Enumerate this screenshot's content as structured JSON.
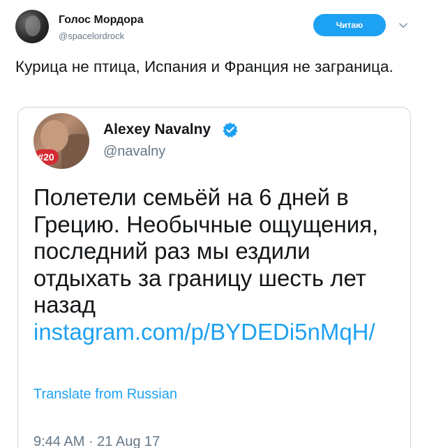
{
  "author": {
    "name": "Голос Мордора",
    "handle": "@spacelordrock",
    "follow_label": "Читаю"
  },
  "tweet": {
    "text": "Курица не птица, Испания и Франция не заграница."
  },
  "quoted": {
    "name": "Alexey Navalny",
    "handle": "@navalny",
    "avatar_badge": "#20",
    "text": "Полетели семьёй на 6 дней в Грецию. Необычные ощущения, последний раз мы ездили отдыхать за границу шесть лет назад",
    "link": "instagram.com/p/BYDEDi5nMqH/",
    "translate_label": "Translate from Russian",
    "timestamp": "9:44 AM · 21 Aug 17"
  },
  "colors": {
    "accent": "#1da1f2",
    "verified": "#1da1f2",
    "badge": "#d62a32"
  },
  "icons": {
    "chevron": "chevron-down-icon",
    "verified": "verified-badge-icon"
  }
}
